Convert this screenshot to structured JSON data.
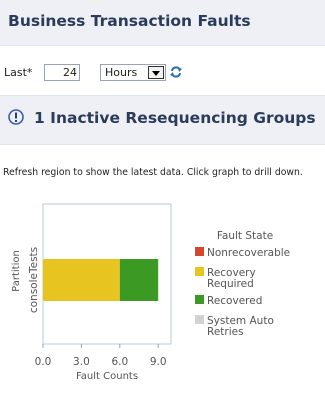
{
  "page": {
    "title": "Business Transaction Faults"
  },
  "filter": {
    "last_label": "Last*",
    "count_value": "24",
    "unit_value": "Hours",
    "refresh_icon": "refresh-icon"
  },
  "section": {
    "title": "1 Inactive Resequencing Groups",
    "icon": "info-icon",
    "hint": "Refresh region to show the latest data. Click graph to drill down."
  },
  "colors": {
    "nonrecoverable": "#d4472a",
    "recovery_required": "#e8c421",
    "recovered": "#3a9a23",
    "system_auto_retries": "#d2d2d2"
  },
  "chart_data": {
    "type": "bar",
    "orientation": "horizontal",
    "stacked": true,
    "categories": [
      "consoleTests"
    ],
    "series": [
      {
        "name": "Nonrecoverable",
        "values": [
          0
        ]
      },
      {
        "name": "Recovery Required",
        "values": [
          6
        ]
      },
      {
        "name": "Recovered",
        "values": [
          3
        ]
      },
      {
        "name": "System Auto Retries",
        "values": [
          0
        ]
      }
    ],
    "xlabel": "Fault Counts",
    "ylabel": "Partition",
    "xlim": [
      0,
      10
    ],
    "xticks": [
      "0.0",
      "3.0",
      "6.0",
      "9.0"
    ],
    "xtick_values": [
      0,
      3,
      6,
      9
    ],
    "legend_title": "Fault State",
    "legend_position": "right",
    "grid": false
  }
}
